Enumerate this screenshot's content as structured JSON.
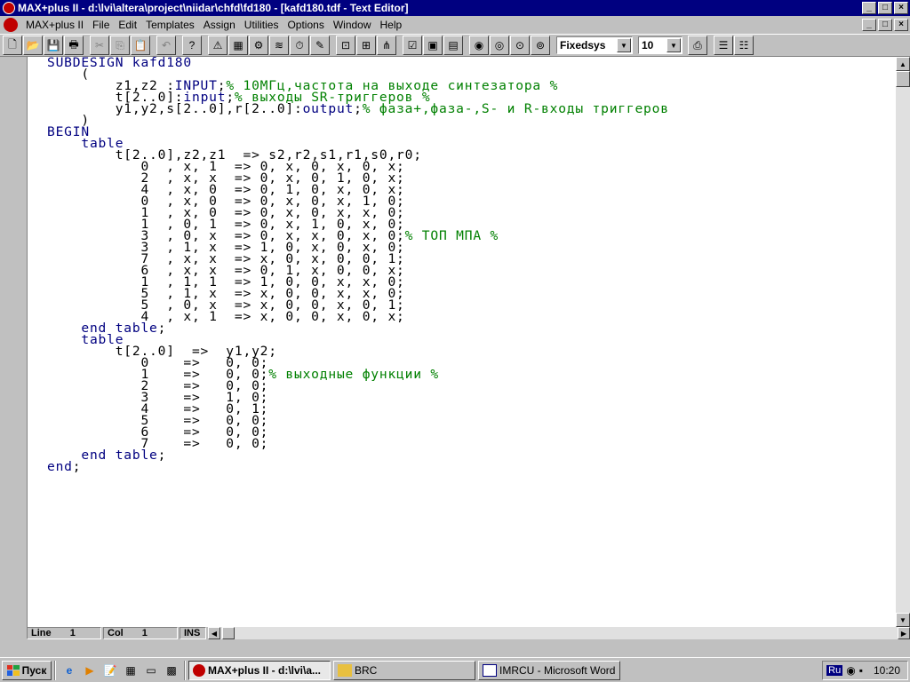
{
  "window": {
    "title": "MAX+plus II - d:\\lvi\\altera\\project\\niidar\\chfd\\fd180 - [kafd180.tdf - Text Editor]"
  },
  "menu": {
    "items": [
      {
        "label": "MAX+plus II"
      },
      {
        "label": "File"
      },
      {
        "label": "Edit"
      },
      {
        "label": "Templates"
      },
      {
        "label": "Assign"
      },
      {
        "label": "Utilities"
      },
      {
        "label": "Options"
      },
      {
        "label": "Window"
      },
      {
        "label": "Help"
      }
    ]
  },
  "toolbar": {
    "font_name": "Fixedsys",
    "font_size": "10"
  },
  "editor": {
    "lines": [
      [
        {
          "t": "SUBDESIGN kafd180",
          "c": "kw"
        }
      ],
      [
        {
          "t": "    (",
          "c": ""
        }
      ],
      [
        {
          "t": "        z1,z2 :",
          "c": ""
        },
        {
          "t": "INPUT",
          "c": "kw"
        },
        {
          "t": ";",
          "c": ""
        },
        {
          "t": "% 10МГц,частота на выходе синтезатора %",
          "c": "cm"
        }
      ],
      [
        {
          "t": "        t[2..0]:",
          "c": ""
        },
        {
          "t": "input",
          "c": "kw"
        },
        {
          "t": ";",
          "c": ""
        },
        {
          "t": "% выходы SR-триггеров %",
          "c": "cm"
        }
      ],
      [
        {
          "t": "        y1,y2,s[2..0],r[2..0]:",
          "c": ""
        },
        {
          "t": "output",
          "c": "kw"
        },
        {
          "t": ";",
          "c": ""
        },
        {
          "t": "% фаза+,фаза-,S- и R-входы триггеров",
          "c": "cm"
        }
      ],
      [
        {
          "t": "    )",
          "c": ""
        }
      ],
      [
        {
          "t": "BEGIN",
          "c": "kw"
        }
      ],
      [
        {
          "t": "    ",
          "c": ""
        },
        {
          "t": "table",
          "c": "kw"
        }
      ],
      [
        {
          "t": "        t[2..0],z2,z1  => s2,r2,s1,r1,s0,r0;",
          "c": ""
        }
      ],
      [
        {
          "t": "           0  , x, 1  => 0, x, 0, x, 0, x;",
          "c": ""
        }
      ],
      [
        {
          "t": "           2  , x, x  => 0, x, 0, 1, 0, x;",
          "c": ""
        }
      ],
      [
        {
          "t": "           4  , x, 0  => 0, 1, 0, x, 0, x;",
          "c": ""
        }
      ],
      [
        {
          "t": "           0  , x, 0  => 0, x, 0, x, 1, 0;",
          "c": ""
        }
      ],
      [
        {
          "t": "           1  , x, 0  => 0, x, 0, x, x, 0;",
          "c": ""
        }
      ],
      [
        {
          "t": "           1  , 0, 1  => 0, x, 1, 0, x, 0;",
          "c": ""
        }
      ],
      [
        {
          "t": "           3  , 0, x  => 0, x, x, 0, x, 0;",
          "c": ""
        },
        {
          "t": "% ТОП МПА %",
          "c": "cm"
        }
      ],
      [
        {
          "t": "           3  , 1, x  => 1, 0, x, 0, x, 0;",
          "c": ""
        }
      ],
      [
        {
          "t": "           7  , x, x  => x, 0, x, 0, 0, 1;",
          "c": ""
        }
      ],
      [
        {
          "t": "           6  , x, x  => 0, 1, x, 0, 0, x;",
          "c": ""
        }
      ],
      [
        {
          "t": "           1  , 1, 1  => 1, 0, 0, x, x, 0;",
          "c": ""
        }
      ],
      [
        {
          "t": "           5  , 1, x  => x, 0, 0, x, x, 0;",
          "c": ""
        }
      ],
      [
        {
          "t": "           5  , 0, x  => x, 0, 0, x, 0, 1;",
          "c": ""
        }
      ],
      [
        {
          "t": "           4  , x, 1  => x, 0, 0, x, 0, x;",
          "c": ""
        }
      ],
      [
        {
          "t": "    ",
          "c": ""
        },
        {
          "t": "end table",
          "c": "kw"
        },
        {
          "t": ";",
          "c": ""
        }
      ],
      [
        {
          "t": "    ",
          "c": ""
        },
        {
          "t": "table",
          "c": "kw"
        }
      ],
      [
        {
          "t": "        t[2..0]  =>  y1,y2;",
          "c": ""
        }
      ],
      [
        {
          "t": "           0    =>   0, 0;",
          "c": ""
        }
      ],
      [
        {
          "t": "           1    =>   0, 0;",
          "c": ""
        },
        {
          "t": "% выходные функции %",
          "c": "cm"
        }
      ],
      [
        {
          "t": "           2    =>   0, 0;",
          "c": ""
        }
      ],
      [
        {
          "t": "           3    =>   1, 0;",
          "c": ""
        }
      ],
      [
        {
          "t": "           4    =>   0, 1;",
          "c": ""
        }
      ],
      [
        {
          "t": "           5    =>   0, 0;",
          "c": ""
        }
      ],
      [
        {
          "t": "           6    =>   0, 0;",
          "c": ""
        }
      ],
      [
        {
          "t": "           7    =>   0, 0;",
          "c": ""
        }
      ],
      [
        {
          "t": "    ",
          "c": ""
        },
        {
          "t": "end table",
          "c": "kw"
        },
        {
          "t": ";",
          "c": ""
        }
      ],
      [
        {
          "t": "end",
          "c": "kw"
        },
        {
          "t": ";",
          "c": ""
        }
      ]
    ]
  },
  "status": {
    "line_label": "Line",
    "line_value": "1",
    "col_label": "Col",
    "col_value": "1",
    "mode": "INS"
  },
  "taskbar": {
    "start_label": "Пуск",
    "tasks": [
      {
        "label": "MAX+plus II - d:\\lvi\\a...",
        "active": true
      },
      {
        "label": "BRC",
        "active": false
      },
      {
        "label": "IMRCU - Microsoft Word",
        "active": false
      }
    ],
    "lang": "Ru",
    "clock": "10:20"
  },
  "colors": {
    "keyword": "#000080",
    "comment": "#008000",
    "titlebar": "#000080"
  }
}
